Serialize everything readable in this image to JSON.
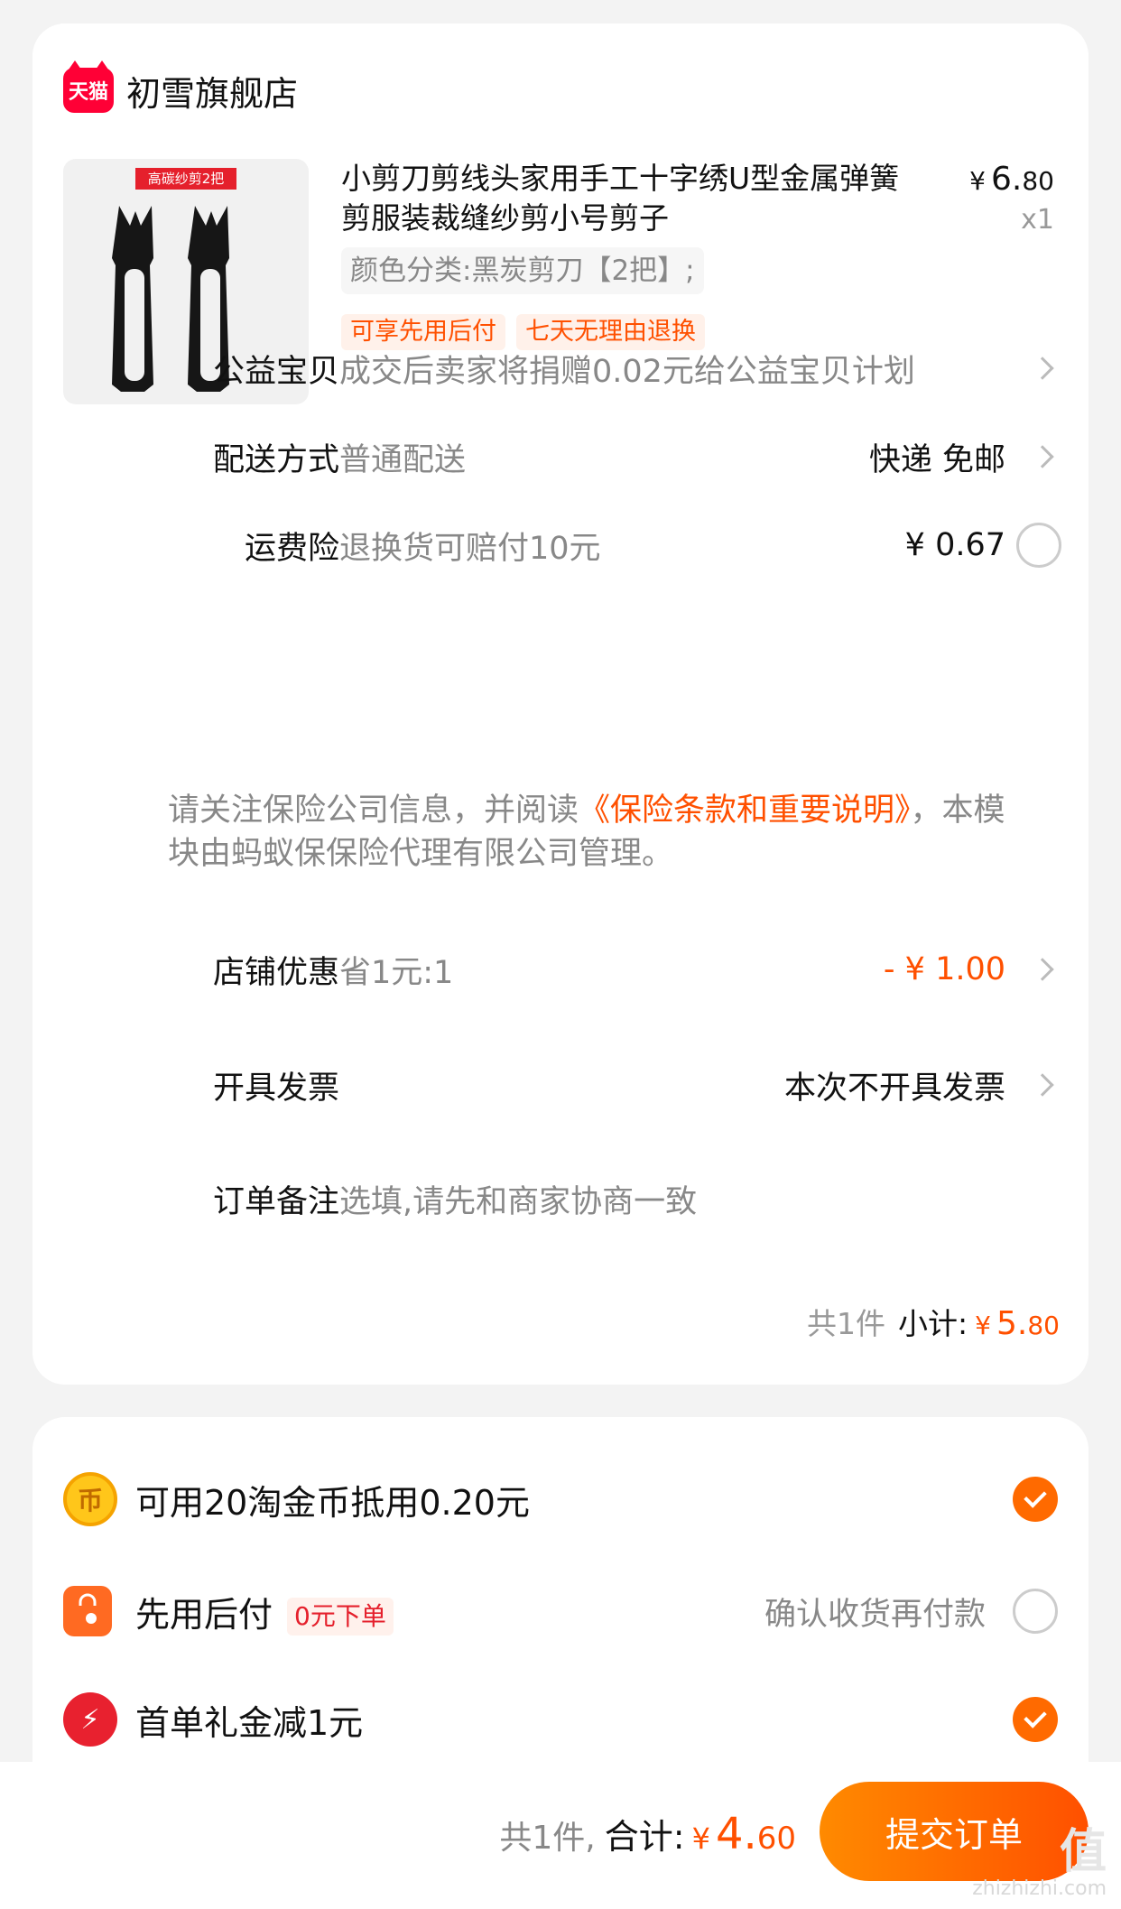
{
  "store": {
    "logo_text": "天猫",
    "name": "初雪旗舰店"
  },
  "product": {
    "thumb_tag": "高碳纱剪2把",
    "title": "小剪刀剪线头家用手工十字绣U型金属弹簧剪服装裁缝纱剪小号剪子",
    "price_currency": "¥",
    "price_int": "6.",
    "price_dec": "80",
    "qty": "x1",
    "sku": "颜色分类:黑炭剪刀【2把】;",
    "tags": [
      "可享先用后付",
      "七天无理由退换"
    ]
  },
  "rows": {
    "charity": {
      "label": "公益宝贝",
      "value": "成交后卖家将捐赠0.02元给公益宝贝计划"
    },
    "delivery": {
      "label": "配送方式",
      "value": "普通配送",
      "right": "快递 免邮"
    },
    "insurance": {
      "label": "运费险",
      "value": "退换货可赔付10元",
      "right": "¥ 0.67"
    },
    "notice_pre": "请关注保险公司信息，并阅读",
    "notice_link": "《保险条款和重要说明》",
    "notice_post": "，本模块由蚂蚁保保险代理有限公司管理。",
    "coupon": {
      "label": "店铺优惠",
      "value": "省1元:1",
      "right": "- ¥ 1.00"
    },
    "invoice": {
      "label": "开具发票",
      "right": "本次不开具发票"
    },
    "remark": {
      "label": "订单备注",
      "placeholder": "选填,请先和商家协商一致"
    }
  },
  "subtotal": {
    "count": "共1件",
    "label": "小计:",
    "currency": "¥",
    "int": "5.",
    "dec": "80"
  },
  "benefits": {
    "coins": {
      "icon_text": "币",
      "text": "可用20淘金币抵用0.20元"
    },
    "pay_later": {
      "text": "先用后付",
      "tag": "0元下单",
      "right": "确认收货再付款"
    },
    "gift": {
      "icon_text": "⚡",
      "text": "首单礼金减1元"
    }
  },
  "footer": {
    "count": "共1件,",
    "label": "合计:",
    "currency": "¥",
    "int": "4.",
    "dec": "60",
    "submit": "提交订单"
  },
  "watermark": {
    "big": "值",
    "small": "zhizhizhi.com"
  },
  "colors": {
    "accent": "#ff5000",
    "tmall": "#ff0036"
  }
}
